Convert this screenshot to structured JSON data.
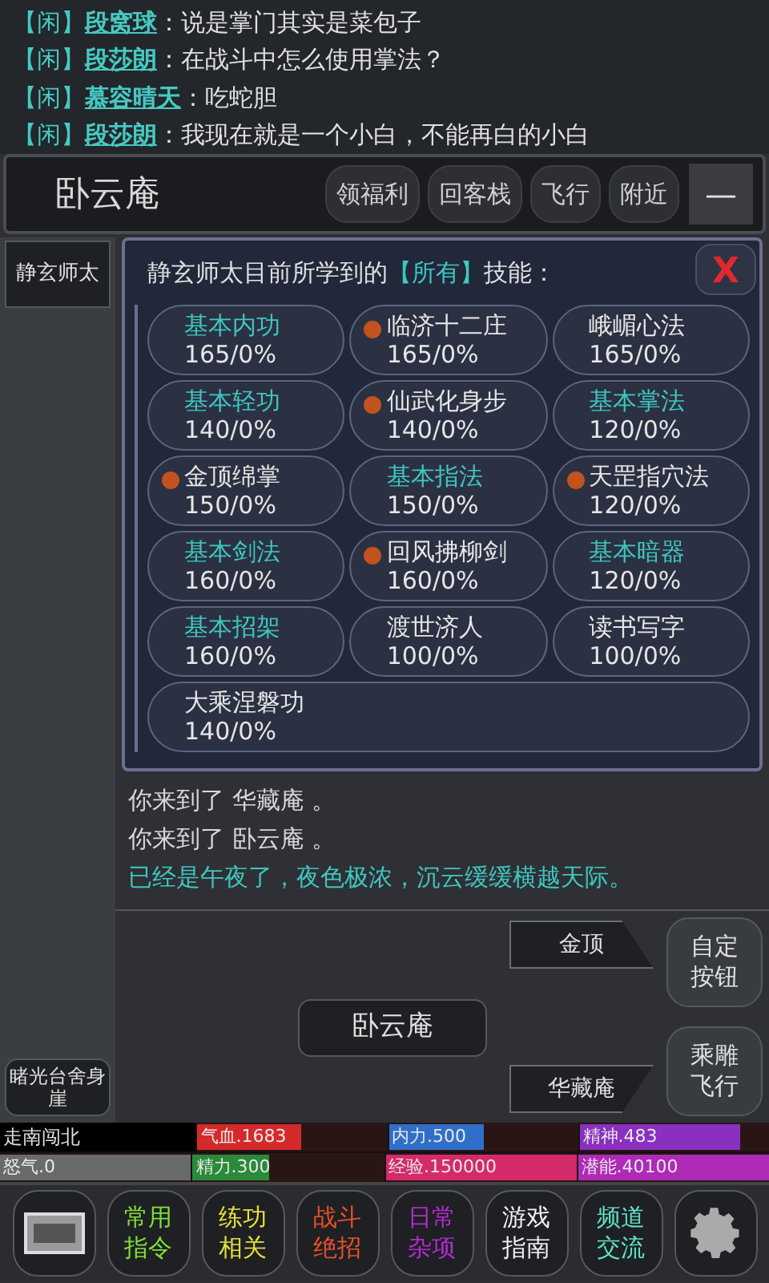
{
  "chat": [
    {
      "channel": "【闲】",
      "name": "段窝球",
      "message": "：说是掌门其实是菜包子"
    },
    {
      "channel": "【闲】",
      "name": "段莎朗",
      "message": "：在战斗中怎么使用掌法？"
    },
    {
      "channel": "【闲】",
      "name": "慕容晴天",
      "message": "：吃蛇胆"
    },
    {
      "channel": "【闲】",
      "name": "段莎朗",
      "message": "：我现在就是一个小白，不能再白的小白"
    }
  ],
  "header": {
    "location": "卧云庵",
    "buttons": [
      "领福利",
      "回客栈",
      "飞行",
      "附近"
    ],
    "collapse": "—"
  },
  "sidebar": {
    "top": "静玄师太",
    "bottom": "睹光台舍身崖"
  },
  "skills_dialog": {
    "title_before": "静玄师太目前所学到的",
    "title_tag": "【所有】",
    "title_after": "技能：",
    "close": "X",
    "skills": [
      {
        "name": "基本内功",
        "value": "165/0%",
        "kind": "basic"
      },
      {
        "name": "临济十二庄",
        "value": "165/0%",
        "kind": "special"
      },
      {
        "name": "峨嵋心法",
        "value": "165/0%",
        "kind": "plain"
      },
      {
        "name": "基本轻功",
        "value": "140/0%",
        "kind": "basic"
      },
      {
        "name": "仙武化身步",
        "value": "140/0%",
        "kind": "special"
      },
      {
        "name": "基本掌法",
        "value": "120/0%",
        "kind": "basic"
      },
      {
        "name": "金顶绵掌",
        "value": "150/0%",
        "kind": "special"
      },
      {
        "name": "基本指法",
        "value": "150/0%",
        "kind": "basic"
      },
      {
        "name": "天罡指穴法",
        "value": "120/0%",
        "kind": "special"
      },
      {
        "name": "基本剑法",
        "value": "160/0%",
        "kind": "basic"
      },
      {
        "name": "回风拂柳剑",
        "value": "160/0%",
        "kind": "special"
      },
      {
        "name": "基本暗器",
        "value": "120/0%",
        "kind": "basic"
      },
      {
        "name": "基本招架",
        "value": "160/0%",
        "kind": "basic"
      },
      {
        "name": "渡世济人",
        "value": "100/0%",
        "kind": "plain"
      },
      {
        "name": "读书写字",
        "value": "100/0%",
        "kind": "plain"
      },
      {
        "name": "大乘涅磐功",
        "value": "140/0%",
        "kind": "plain"
      }
    ]
  },
  "messages": [
    {
      "text": "你来到了 华藏庵 。",
      "kind": "normal"
    },
    {
      "text": "你来到了 卧云庵 。",
      "kind": "normal"
    },
    {
      "text": "已经是午夜了，夜色极浓，沉云缓缓横越天际。",
      "kind": "highlight"
    }
  ],
  "navigation": {
    "north": "金顶",
    "current": "卧云庵",
    "south": "华藏庵",
    "side_buttons": [
      "自定按钮",
      "乘雕飞行"
    ]
  },
  "stats": [
    [
      {
        "label": "走南闯北",
        "kind": "label"
      },
      {
        "label": "气血.1683",
        "kind": "bar",
        "color": "#d42a2a",
        "level": 0.55
      },
      {
        "label": "内力.500",
        "kind": "bar",
        "color": "#2f6fc9",
        "level": 0.5
      },
      {
        "label": "精神.483",
        "kind": "bar",
        "color": "#8a2fc0",
        "level": 0.85
      }
    ],
    [
      {
        "label": "怒气.0",
        "kind": "bar",
        "color": "#6a6a6a",
        "level": 1
      },
      {
        "label": "精力.300",
        "kind": "bar",
        "color": "#2a8a3a",
        "level": 0.4
      },
      {
        "label": "经验.150000",
        "kind": "bar",
        "color": "#d42a6a",
        "level": 1
      },
      {
        "label": "潜能.40100",
        "kind": "bar",
        "color": "#b02ab8",
        "level": 1
      }
    ]
  ],
  "toolbar": [
    {
      "kind": "image"
    },
    {
      "kind": "text",
      "label": "常用指令",
      "color": "#7ee03a"
    },
    {
      "kind": "text",
      "label": "练功相关",
      "color": "#e6e03a"
    },
    {
      "kind": "text",
      "label": "战斗绝招",
      "color": "#e8502a"
    },
    {
      "kind": "text",
      "label": "日常杂项",
      "color": "#b52ad0"
    },
    {
      "kind": "text",
      "label": "游戏指南",
      "color": "#f0f0f0"
    },
    {
      "kind": "text",
      "label": "频道交流",
      "color": "#5fe0c8"
    },
    {
      "kind": "gear"
    }
  ]
}
